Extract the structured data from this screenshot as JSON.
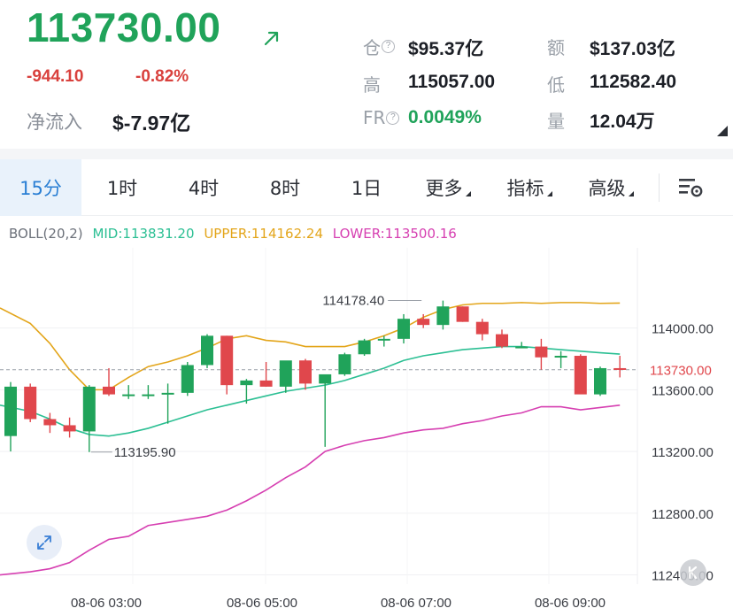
{
  "ticker": {
    "last_price": "113730.00",
    "change": "-944.10",
    "change_pct": "-0.82%",
    "net_inflow_label": "净流入",
    "net_inflow_value": "$-7.97亿",
    "trend_icon": "arrow-up-right-icon"
  },
  "stats": {
    "position_label": "仓",
    "position_value": "$95.37亿",
    "amount_label": "额",
    "amount_value": "$137.03亿",
    "high_label": "高",
    "high_value": "115057.00",
    "low_label": "低",
    "low_value": "112582.40",
    "funding_label": "FR",
    "funding_value": "0.0049%",
    "volume_label": "量",
    "volume_value": "12.04万",
    "help_icon": "?"
  },
  "tabs": [
    {
      "label": "15分",
      "active": true
    },
    {
      "label": "1时"
    },
    {
      "label": "4时"
    },
    {
      "label": "8时"
    },
    {
      "label": "1日"
    },
    {
      "label": "更多",
      "dropdown": true
    },
    {
      "label": "指标",
      "dropdown": true
    },
    {
      "label": "高级",
      "dropdown": true
    }
  ],
  "settings_icon": "chart-settings-icon",
  "indicator": {
    "name": "BOLL(20,2)",
    "mid": "MID:113831.20",
    "upper": "UPPER:114162.24",
    "lower": "LOWER:113500.16"
  },
  "colors": {
    "up": "#20a35a",
    "down": "#e0474c",
    "mid_line": "#2bbf93",
    "upper_line": "#e3a51a",
    "lower_line": "#d63fb1",
    "price_label": "#e0474c",
    "tab_active_text": "#2a7fd4"
  },
  "chart_data": {
    "type": "candlestick",
    "y_ticks": [
      "114000.00",
      "113600.00",
      "113200.00",
      "112800.00",
      "112400.00"
    ],
    "y_tick_values": [
      114000,
      113600,
      113200,
      112800,
      112400
    ],
    "ylim": [
      112340,
      114520
    ],
    "x_ticks": [
      "08-06 03:00",
      "08-06 05:00",
      "08-06 07:00",
      "08-06 09:00"
    ],
    "current_price": 113730.0,
    "current_price_label": "113730.00",
    "annotations": [
      {
        "text": "114178.40",
        "value": 114178.4,
        "candle": 21
      },
      {
        "text": "113195.90",
        "value": 113195.9,
        "candle": 4
      }
    ],
    "candles": [
      {
        "o": 113300,
        "h": 113650,
        "l": 113200,
        "c": 113620
      },
      {
        "o": 113620,
        "h": 113640,
        "l": 113390,
        "c": 113410
      },
      {
        "o": 113410,
        "h": 113450,
        "l": 113320,
        "c": 113370
      },
      {
        "o": 113370,
        "h": 113420,
        "l": 113290,
        "c": 113330
      },
      {
        "o": 113330,
        "h": 113630,
        "l": 113196,
        "c": 113620
      },
      {
        "o": 113620,
        "h": 113740,
        "l": 113560,
        "c": 113570
      },
      {
        "o": 113570,
        "h": 113630,
        "l": 113540,
        "c": 113570
      },
      {
        "o": 113570,
        "h": 113630,
        "l": 113540,
        "c": 113570
      },
      {
        "o": 113570,
        "h": 113640,
        "l": 113380,
        "c": 113580
      },
      {
        "o": 113580,
        "h": 113780,
        "l": 113560,
        "c": 113760
      },
      {
        "o": 113760,
        "h": 113960,
        "l": 113740,
        "c": 113950
      },
      {
        "o": 113950,
        "h": 113950,
        "l": 113570,
        "c": 113630
      },
      {
        "o": 113630,
        "h": 113670,
        "l": 113510,
        "c": 113660
      },
      {
        "o": 113660,
        "h": 113780,
        "l": 113620,
        "c": 113620
      },
      {
        "o": 113620,
        "h": 113760,
        "l": 113580,
        "c": 113790
      },
      {
        "o": 113790,
        "h": 113800,
        "l": 113600,
        "c": 113640
      },
      {
        "o": 113640,
        "h": 113680,
        "l": 113230,
        "c": 113700
      },
      {
        "o": 113700,
        "h": 113840,
        "l": 113690,
        "c": 113830
      },
      {
        "o": 113830,
        "h": 113930,
        "l": 113820,
        "c": 113920
      },
      {
        "o": 113920,
        "h": 113950,
        "l": 113880,
        "c": 113930
      },
      {
        "o": 113930,
        "h": 114090,
        "l": 113900,
        "c": 114060
      },
      {
        "o": 114060,
        "h": 114090,
        "l": 114000,
        "c": 114020
      },
      {
        "o": 114020,
        "h": 114178,
        "l": 113990,
        "c": 114140
      },
      {
        "o": 114140,
        "h": 114140,
        "l": 114040,
        "c": 114040
      },
      {
        "o": 114040,
        "h": 114060,
        "l": 113920,
        "c": 113960
      },
      {
        "o": 113960,
        "h": 113990,
        "l": 113870,
        "c": 113880
      },
      {
        "o": 113880,
        "h": 113910,
        "l": 113880,
        "c": 113880
      },
      {
        "o": 113880,
        "h": 113930,
        "l": 113730,
        "c": 113810
      },
      {
        "o": 113810,
        "h": 113850,
        "l": 113740,
        "c": 113820
      },
      {
        "o": 113820,
        "h": 113830,
        "l": 113580,
        "c": 113570
      },
      {
        "o": 113570,
        "h": 113750,
        "l": 113560,
        "c": 113740
      },
      {
        "o": 113740,
        "h": 113820,
        "l": 113680,
        "c": 113730
      }
    ],
    "bands": {
      "upper": [
        114130,
        114030,
        113900,
        113730,
        113600,
        113600,
        113680,
        113750,
        113780,
        113820,
        113870,
        113930,
        113950,
        113920,
        113910,
        113880,
        113880,
        113880,
        113910,
        113950,
        114000,
        114070,
        114120,
        114150,
        114160,
        114160,
        114165,
        114160,
        114165,
        114165,
        114160,
        114162
      ],
      "mid": [
        113500,
        113460,
        113410,
        113350,
        113310,
        113300,
        113320,
        113350,
        113390,
        113430,
        113470,
        113500,
        113530,
        113560,
        113590,
        113610,
        113630,
        113660,
        113700,
        113740,
        113790,
        113820,
        113840,
        113860,
        113870,
        113880,
        113880,
        113870,
        113860,
        113850,
        113840,
        113831
      ],
      "lower": [
        112400,
        112420,
        112440,
        112480,
        112560,
        112630,
        112650,
        112720,
        112740,
        112760,
        112780,
        112820,
        112880,
        112950,
        113030,
        113100,
        113200,
        113240,
        113270,
        113290,
        113320,
        113340,
        113350,
        113380,
        113400,
        113430,
        113450,
        113490,
        113490,
        113470,
        113485,
        113500
      ]
    }
  }
}
